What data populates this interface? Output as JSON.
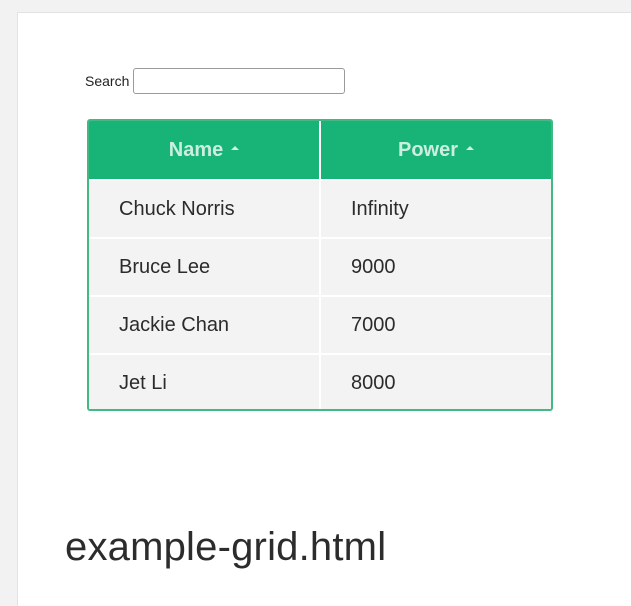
{
  "search": {
    "label": "Search",
    "value": "",
    "placeholder": ""
  },
  "grid": {
    "columns": [
      {
        "label": "Name",
        "sort": "asc"
      },
      {
        "label": "Power",
        "sort": "asc"
      }
    ],
    "rows": [
      {
        "name": "Chuck Norris",
        "power": "Infinity"
      },
      {
        "name": "Bruce Lee",
        "power": "9000"
      },
      {
        "name": "Jackie Chan",
        "power": "7000"
      },
      {
        "name": "Jet Li",
        "power": "8000"
      }
    ],
    "accent_color": "#42b983",
    "header_color": "#17b377"
  },
  "caption": {
    "title": "example-grid.html"
  }
}
